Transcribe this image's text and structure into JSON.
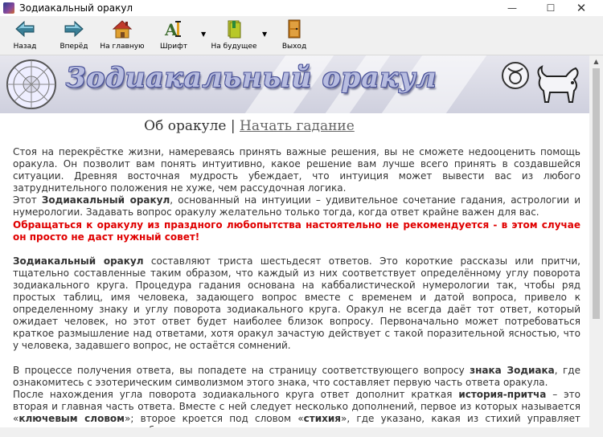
{
  "window": {
    "title": "Зодиакальный оракул"
  },
  "toolbar": {
    "back_label": "Назад",
    "forward_label": "Вперёд",
    "home_label": "На главную",
    "font_label": "Шрифт",
    "future_label": "На будущее",
    "exit_label": "Выход"
  },
  "banner": {
    "title": "Зодиакальный оракул"
  },
  "nav": {
    "about": "Об оракуле",
    "separator": "|",
    "start": "Начать гадание"
  },
  "paragraphs": {
    "p1": "Стоя на перекрёстке жизни, намереваясь принять важные решения, вы не сможете недооценить помощь оракула. Он позволит вам понять интуитивно, какое решение вам лучше всего принять в создавшейся ситуации. Древняя восточная мудрость убеждает, что интуиция может вывести вас из любого затруднительного положения не хуже, чем рассудочная логика.",
    "p2_pre": "Этот ",
    "p2_bold": "Зодиакальный оракул",
    "p2_post": ", основанный на интуиции – удивительное сочетание гадания, астрологии и нумерологии. Задавать вопрос оракулу желательно только тогда, когда ответ крайне важен для вас.",
    "warning": "Обращаться к оракулу из праздного любопытства настоятельно не рекомендуется - в этом случае он просто не даст нужный совет!",
    "p3_bold": "Зодиакальный оракул",
    "p3_post": " составляют триста шестьдесят ответов. Это короткие рассказы или притчи, тщательно составленные таким образом, что каждый из них соответствует определённому углу поворота зодиакального круга. Процедура гадания основана на каббалистической нумерологии так, чтобы ряд простых таблиц, имя человека, задающего вопрос вместе с временем и датой вопроса, привело к определенному знаку и углу поворота зодиакального круга. Оракул не всегда даёт тот ответ, который ожидает человек, но этот ответ будет наиболее близок вопросу. Первоначально может потребоваться краткое размышление над ответами, хотя оракул зачастую действует с такой поразительной ясностью, что у человека, задавшего вопрос, не остаётся сомнений.",
    "p4_pre": "В процессе получения ответа, вы попадете на страницу соответствующего вопросу ",
    "p4_bold": "знака Зодиака",
    "p4_post": ", где ознакомитесь с эзотерическим символизмом этого знака, что составляет первую часть ответа оракула.",
    "p5_a": "После нахождения угла поворота зодиакального круга ответ дополнит краткая ",
    "p5_b": "история-притча",
    "p5_c": " – это вторая и главная часть ответа. Вместе с ней следует несколько дополнений, первое из которых называется «",
    "p5_d": "ключевым словом",
    "p5_e": "»; второе кроется под словом «",
    "p5_f": "стихия",
    "p5_g": "», где указано, какая из стихий управляет данным знаком вместе с объяснением значения, с которым вы сможете познакомиться, нажав на"
  },
  "colors": {
    "warning": "#e00000",
    "text": "#333333",
    "banner": "#cfd0de"
  }
}
